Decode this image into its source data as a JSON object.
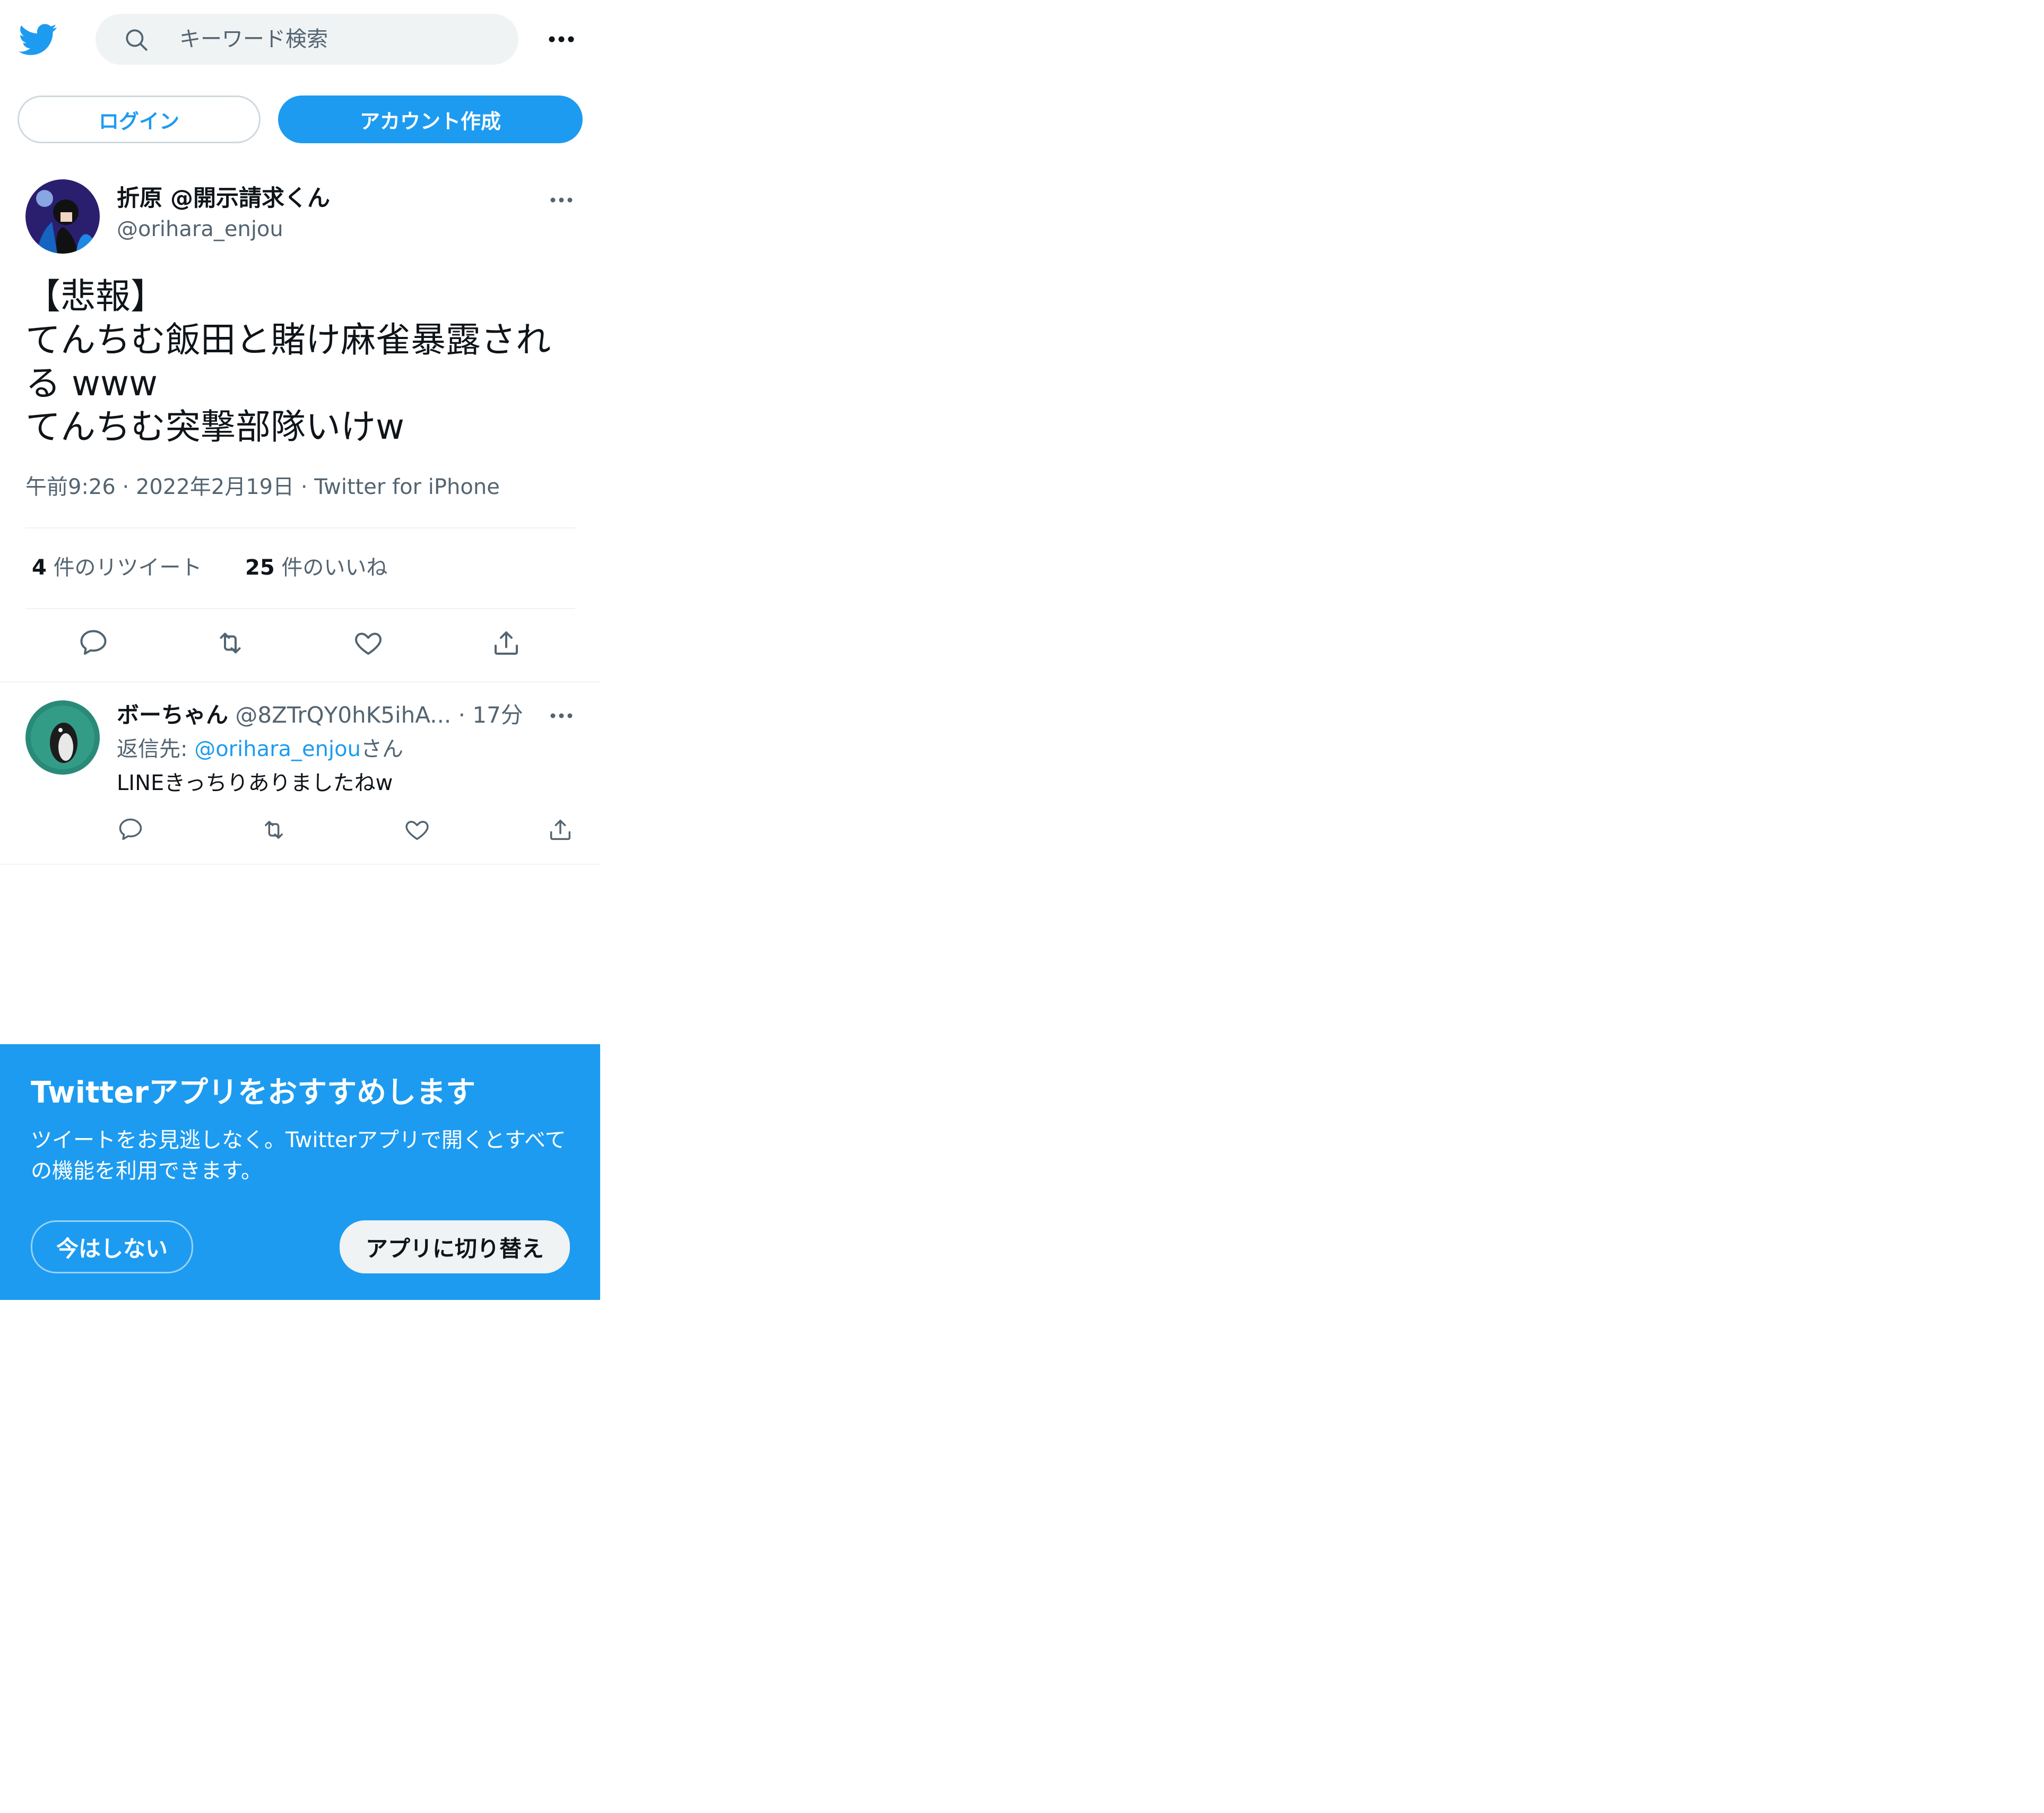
{
  "header": {
    "search_placeholder": "キーワード検索"
  },
  "auth": {
    "login_label": "ログイン",
    "signup_label": "アカウント作成"
  },
  "tweet": {
    "author_name": "折原 @開示請求くん",
    "author_handle": "@orihara_enjou",
    "text": "【悲報】\nてんちむ飯田と賭け麻雀暴露される www\nてんちむ突撃部隊いけw",
    "time": "午前9:26",
    "date": "2022年2月19日",
    "source": "Twitter for iPhone",
    "retweet_count": "4",
    "retweet_label": "件のリツイート",
    "like_count": "25",
    "like_label": "件のいいね"
  },
  "reply": {
    "author_name": "ボーちゃん",
    "author_handle": "@8ZTrQY0hK5ihA...",
    "time": "17分",
    "reply_to_prefix": "返信先: ",
    "reply_to_handle": "@orihara_enjou",
    "reply_to_suffix": "さん",
    "text": "LINEきっちりありましたねw"
  },
  "banner": {
    "title": "Twitterアプリをおすすめします",
    "body": "ツイートをお見逃しなく。Twitterアプリで開くとすべての機能を利用できます。",
    "not_now_label": "今はしない",
    "switch_label": "アプリに切り替え"
  },
  "colors": {
    "brand": "#1d9bf0",
    "text": "#0f1419",
    "secondary": "#536471"
  }
}
